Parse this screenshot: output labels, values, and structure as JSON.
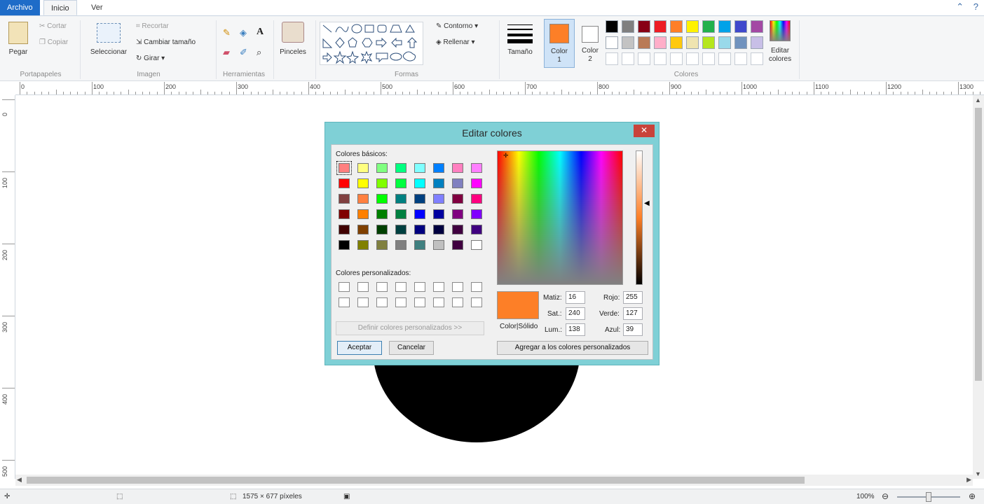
{
  "tabs": [
    "Archivo",
    "Inicio",
    "Ver"
  ],
  "ribbon": {
    "clipboard": {
      "paste": "Pegar",
      "cut": "Cortar",
      "copy": "Copiar",
      "label": "Portapapeles"
    },
    "image": {
      "select": "Seleccionar",
      "crop": "Recortar",
      "resize": "Cambiar tamaño",
      "rotate": "Girar",
      "label": "Imagen"
    },
    "tools": {
      "label": "Herramientas"
    },
    "brushes": {
      "label": "Pinceles"
    },
    "shapes": {
      "outline": "Contorno",
      "fill": "Rellenar",
      "label": "Formas"
    },
    "size": {
      "label": "Tamaño"
    },
    "color1": {
      "label_line1": "Color",
      "label_line2": "1",
      "value": "#fd7f27"
    },
    "color2": {
      "label_line1": "Color",
      "label_line2": "2",
      "value": "#ffffff"
    },
    "colors": {
      "label": "Colores",
      "row1": [
        "#000000",
        "#7f7f7f",
        "#880015",
        "#ed1c24",
        "#ff7f27",
        "#fff200",
        "#22b14c",
        "#00a2e8",
        "#3f48cc",
        "#a349a4"
      ],
      "row2": [
        "#ffffff",
        "#c3c3c3",
        "#b97a57",
        "#ffaec9",
        "#ffc90e",
        "#efe4b0",
        "#b5e61d",
        "#99d9ea",
        "#7092be",
        "#c8bfe7"
      ]
    },
    "edit_colors": {
      "line1": "Editar",
      "line2": "colores"
    }
  },
  "ruler": {
    "top": [
      "0",
      "100",
      "200",
      "300",
      "400",
      "500",
      "600",
      "700",
      "800",
      "900",
      "1000",
      "1100",
      "1200",
      "1300"
    ],
    "left": [
      "0",
      "100",
      "200",
      "300",
      "400",
      "500"
    ]
  },
  "status": {
    "dimensions": "1575 × 677 píxeles",
    "zoom": "100%"
  },
  "dialog": {
    "title": "Editar colores",
    "basic_colors_label": "Colores básicos:",
    "custom_colors_label": "Colores personalizados:",
    "define_custom": "Definir colores personalizados >>",
    "ok": "Aceptar",
    "cancel": "Cancelar",
    "add_custom": "Agregar a los colores personalizados",
    "color_solid": "Color|Sólido",
    "fields": {
      "hue_label": "Matiz:",
      "hue": "16",
      "sat_label": "Sat.:",
      "sat": "240",
      "lum_label": "Lum.:",
      "lum": "138",
      "red_label": "Rojo:",
      "red": "255",
      "green_label": "Verde:",
      "green": "127",
      "blue_label": "Azul:",
      "blue": "39"
    },
    "basic_colors": [
      [
        "#ff8080",
        "#ffff80",
        "#80ff80",
        "#00ff80",
        "#80ffff",
        "#0080ff",
        "#ff80c0",
        "#ff80ff"
      ],
      [
        "#ff0000",
        "#ffff00",
        "#80ff00",
        "#00ff40",
        "#00ffff",
        "#0080c0",
        "#8080c0",
        "#ff00ff"
      ],
      [
        "#804040",
        "#ff8040",
        "#00ff00",
        "#008080",
        "#004080",
        "#8080ff",
        "#800040",
        "#ff0080"
      ],
      [
        "#800000",
        "#ff8000",
        "#008000",
        "#008040",
        "#0000ff",
        "#0000a0",
        "#800080",
        "#8000ff"
      ],
      [
        "#400000",
        "#804000",
        "#004000",
        "#004040",
        "#000080",
        "#000040",
        "#400040",
        "#400080"
      ],
      [
        "#000000",
        "#808000",
        "#808040",
        "#808080",
        "#408080",
        "#c0c0c0",
        "#400040",
        "#ffffff"
      ]
    ]
  }
}
